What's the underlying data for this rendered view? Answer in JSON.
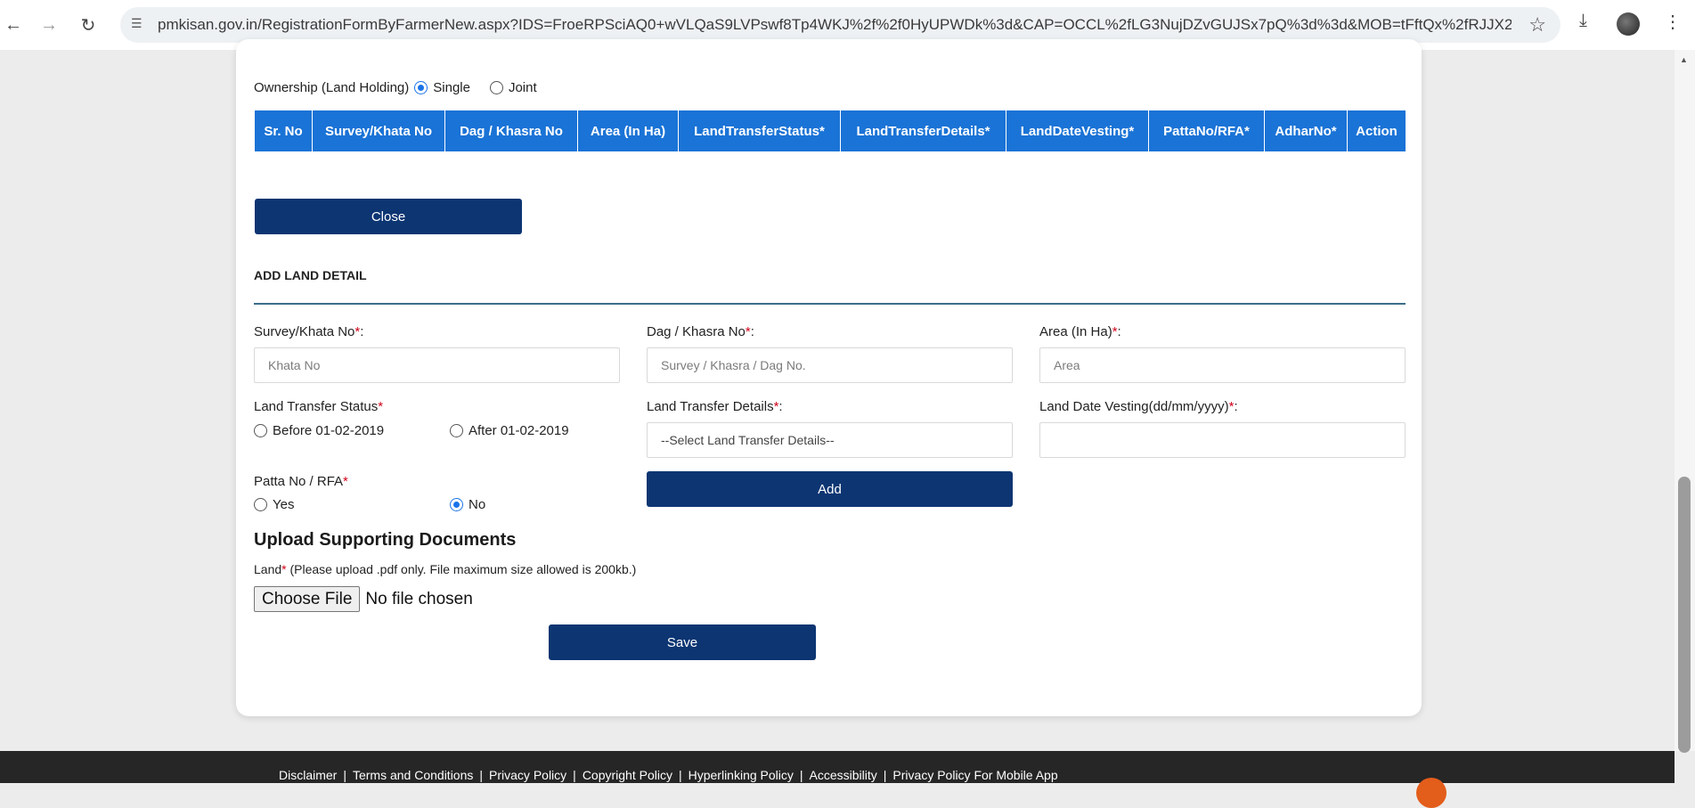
{
  "browser": {
    "url": "pmkisan.gov.in/RegistrationFormByFarmerNew.aspx?IDS=FroeRPSciAQ0+wVLQaS9LVPswf8Tp4WKJ%2f%2f0HyUPWDk%3d&CAP=OCCL%2fLG3NujDZvGUJSx7pQ%3d%3d&MOB=tFftQx%2fRJJX2e..."
  },
  "ownership": {
    "label": "Ownership (Land Holding)",
    "options": [
      {
        "label": "Single",
        "checked": true
      },
      {
        "label": "Joint",
        "checked": false
      }
    ]
  },
  "land_table": {
    "columns": [
      "Sr. No",
      "Survey/Khata No",
      "Dag / Khasra No",
      "Area (In Ha)",
      "LandTransferStatus*",
      "LandTransferDetails*",
      "LandDateVesting*",
      "PattaNo/RFA*",
      "AdharNo*",
      "Action"
    ]
  },
  "close_label": "Close",
  "add_land": {
    "title": "ADD LAND DETAIL",
    "survey": {
      "label": "Survey/Khata No",
      "req": "*",
      "colon": ":",
      "placeholder": "Khata No"
    },
    "dag": {
      "label": "Dag / Khasra No",
      "req": "*",
      "colon": ":",
      "placeholder": "Survey / Khasra / Dag No."
    },
    "area": {
      "label": "Area (In Ha)",
      "req": "*",
      "colon": ":",
      "placeholder": "Area"
    },
    "transfer_status": {
      "label": "Land Transfer Status",
      "req": "*",
      "options": [
        {
          "label": "Before 01-02-2019",
          "checked": false
        },
        {
          "label": "After 01-02-2019",
          "checked": false
        }
      ]
    },
    "transfer_details": {
      "label": "Land Transfer Details",
      "req": "*",
      "colon": ":",
      "selected": "--Select Land Transfer Details--"
    },
    "date_vesting": {
      "label": "Land Date Vesting(dd/mm/yyyy)",
      "req": "*",
      "colon": ":",
      "value": ""
    },
    "patta": {
      "label": "Patta No / RFA",
      "req": "*",
      "options": [
        {
          "label": "Yes",
          "checked": false
        },
        {
          "label": "No",
          "checked": true
        }
      ]
    },
    "add_label": "Add"
  },
  "upload": {
    "title": "Upload Supporting Documents",
    "land_label": "Land",
    "land_req": "*",
    "land_note": " (Please upload .pdf only. File maximum size allowed is 200kb.)",
    "choose_label": "Choose File",
    "no_file": "No file chosen"
  },
  "save_label": "Save",
  "footer": {
    "links": [
      "Disclaimer",
      "Terms and Conditions",
      "Privacy Policy",
      "Copyright Policy",
      "Hyperlinking Policy",
      "Accessibility",
      "Privacy Policy For Mobile App"
    ],
    "separator": "|"
  },
  "icons": {
    "back": "back-arrow-icon",
    "forward": "forward-arrow-icon",
    "reload": "reload-icon",
    "site_settings": "tune-icon",
    "bookmark": "star-icon",
    "download": "download-icon",
    "profile": "avatar",
    "menu": "more-vert-icon"
  },
  "colors": {
    "table_header": "#1a73d6",
    "button_navy": "#0c3572",
    "required": "#d0021b",
    "footer_bg": "#262626"
  }
}
